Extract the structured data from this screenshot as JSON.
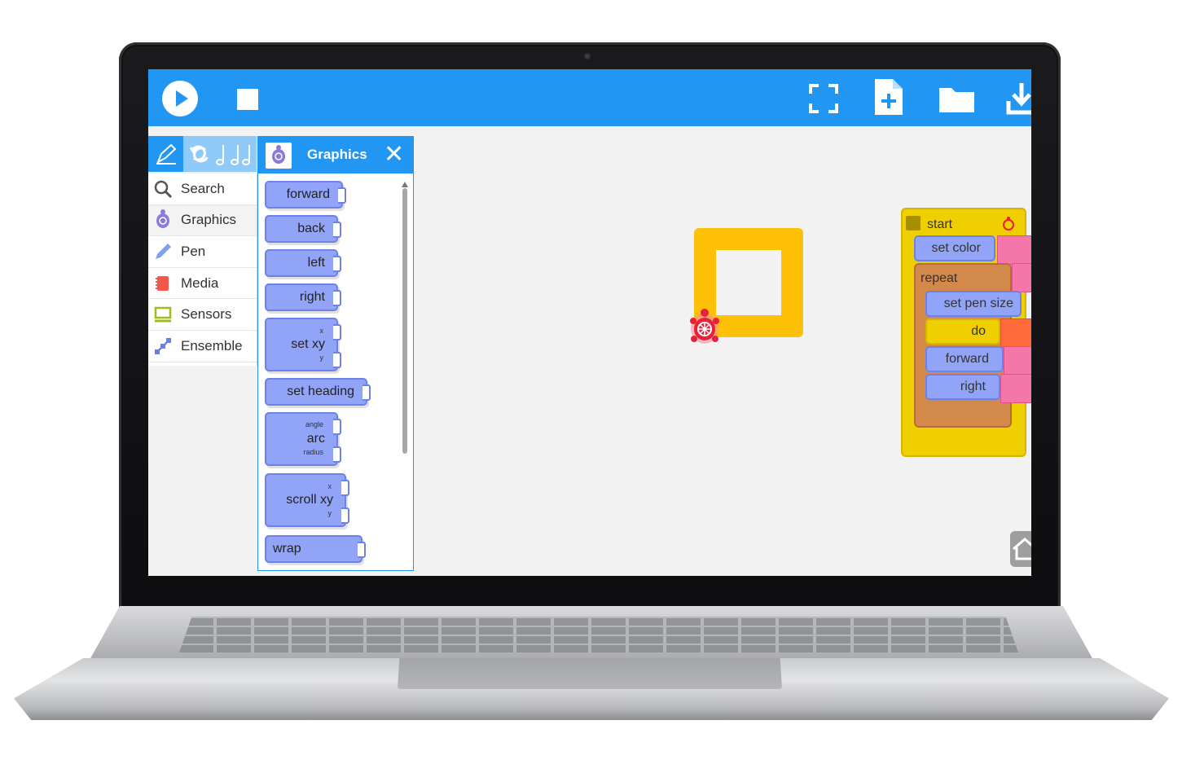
{
  "toolbar": {
    "play": "play-icon",
    "stop": "stop-icon",
    "fullscreen": "fullscreen-icon",
    "new_file": "new-file-icon",
    "open": "folder-icon",
    "save": "download-icon",
    "color": "#2196f3"
  },
  "palette_tabs": [
    "pen-icon",
    "rhythm-icon"
  ],
  "categories": [
    {
      "label": "Search",
      "icon": "search-icon"
    },
    {
      "label": "Graphics",
      "icon": "turtle-icon"
    },
    {
      "label": "Pen",
      "icon": "pen-icon"
    },
    {
      "label": "Media",
      "icon": "media-icon"
    },
    {
      "label": "Sensors",
      "icon": "sensors-icon"
    },
    {
      "label": "Ensemble",
      "icon": "ensemble-icon"
    }
  ],
  "blocks_panel": {
    "title": "Graphics",
    "blocks": {
      "forward": "forward",
      "back": "back",
      "left": "left",
      "right": "right",
      "set_xy": "set xy",
      "set_xy_x": "x",
      "set_xy_y": "y",
      "set_heading": "set heading",
      "arc": "arc",
      "arc_angle": "angle",
      "arc_radius": "radius",
      "scroll_xy": "scroll xy",
      "scroll_x": "x",
      "scroll_y": "y",
      "wrap": "wrap"
    }
  },
  "program": {
    "start": "start",
    "set_color": "set color",
    "repeat": "repeat",
    "set_pen_size": "set pen size",
    "do": "do",
    "forward": "forward",
    "right": "right"
  },
  "colors": {
    "drawing": "#ffc107",
    "turtle": "#e8213b",
    "block_blue": "#92a4f7",
    "block_yellow": "#f0cf00",
    "block_orange": "#d2894a"
  }
}
